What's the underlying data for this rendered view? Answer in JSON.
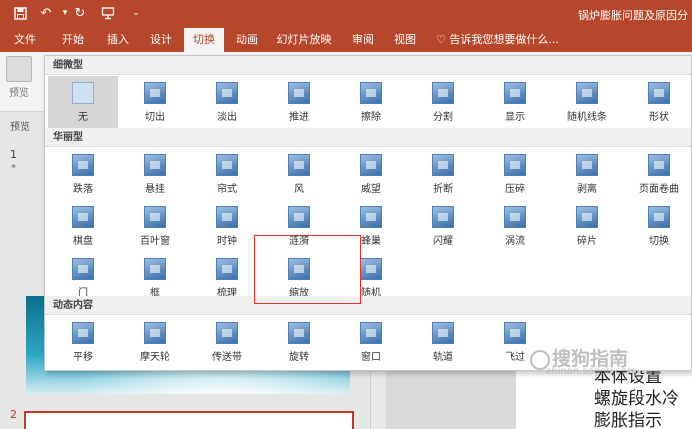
{
  "titlebar": {
    "title": "锅炉膨胀问题及原因分",
    "icons": [
      "save-icon",
      "undo-icon",
      "redo-icon",
      "present-from-start-icon",
      "customize-toolbar-icon"
    ]
  },
  "tabs": [
    {
      "label": "文件",
      "active": false
    },
    {
      "label": "开始",
      "active": false
    },
    {
      "label": "插入",
      "active": false
    },
    {
      "label": "设计",
      "active": false
    },
    {
      "label": "切换",
      "active": true
    },
    {
      "label": "动画",
      "active": false
    },
    {
      "label": "幻灯片放映",
      "active": false
    },
    {
      "label": "审阅",
      "active": false
    },
    {
      "label": "视图",
      "active": false
    }
  ],
  "tell_me": "♡ 告诉我您想要做什么...",
  "ribbon": {
    "preview_label": "预览",
    "preview_group_label": "预览"
  },
  "slides_pane": {
    "slide1_number": "1",
    "slide1_star": "*",
    "slide2_number": "2"
  },
  "slide": {
    "lines": [
      "本体设置",
      "螺旋段水冷",
      "膨胀指示"
    ]
  },
  "watermark": {
    "main": "搜狗指南",
    "sub": "zhinan.sogou.com"
  },
  "gallery": {
    "sections": [
      {
        "title": "细微型",
        "items": [
          {
            "label": "无",
            "icon": "none-transition-icon",
            "selected": true
          },
          {
            "label": "切出",
            "icon": "cut-transition-icon"
          },
          {
            "label": "淡出",
            "icon": "fade-transition-icon"
          },
          {
            "label": "推进",
            "icon": "push-transition-icon"
          },
          {
            "label": "擦除",
            "icon": "wipe-transition-icon"
          },
          {
            "label": "分割",
            "icon": "split-transition-icon"
          },
          {
            "label": "显示",
            "icon": "reveal-transition-icon"
          },
          {
            "label": "随机线条",
            "icon": "random-bars-transition-icon"
          },
          {
            "label": "形状",
            "icon": "shape-transition-icon"
          }
        ]
      },
      {
        "title": "华丽型",
        "items": [
          {
            "label": "跌落",
            "icon": "fall-over-transition-icon"
          },
          {
            "label": "悬挂",
            "icon": "drape-transition-icon"
          },
          {
            "label": "帘式",
            "icon": "curtains-transition-icon"
          },
          {
            "label": "风",
            "icon": "wind-transition-icon"
          },
          {
            "label": "威望",
            "icon": "prestige-transition-icon"
          },
          {
            "label": "折断",
            "icon": "fracture-transition-icon"
          },
          {
            "label": "压碎",
            "icon": "crush-transition-icon"
          },
          {
            "label": "剥离",
            "icon": "peel-off-transition-icon"
          },
          {
            "label": "页面卷曲",
            "icon": "page-curl-transition-icon"
          },
          {
            "label": "棋盘",
            "icon": "checkerboard-transition-icon"
          },
          {
            "label": "百叶窗",
            "icon": "blinds-transition-icon"
          },
          {
            "label": "时钟",
            "icon": "clock-transition-icon"
          },
          {
            "label": "涟漪",
            "icon": "ripple-transition-icon"
          },
          {
            "label": "蜂巢",
            "icon": "honeycomb-transition-icon"
          },
          {
            "label": "闪耀",
            "icon": "glitter-transition-icon"
          },
          {
            "label": "涡流",
            "icon": "vortex-transition-icon"
          },
          {
            "label": "碎片",
            "icon": "shred-transition-icon"
          },
          {
            "label": "切换",
            "icon": "switch-transition-icon"
          },
          {
            "label": "门",
            "icon": "doors-transition-icon"
          },
          {
            "label": "框",
            "icon": "box-transition-icon"
          },
          {
            "label": "梳理",
            "icon": "comb-transition-icon"
          },
          {
            "label": "缩放",
            "icon": "zoom-transition-icon"
          },
          {
            "label": "随机",
            "icon": "random-transition-icon"
          }
        ]
      },
      {
        "title": "动态内容",
        "items": [
          {
            "label": "平移",
            "icon": "pan-transition-icon"
          },
          {
            "label": "摩天轮",
            "icon": "ferris-wheel-transition-icon"
          },
          {
            "label": "传送带",
            "icon": "conveyor-transition-icon"
          },
          {
            "label": "旋转",
            "icon": "rotate-transition-icon"
          },
          {
            "label": "窗口",
            "icon": "window-transition-icon"
          },
          {
            "label": "轨道",
            "icon": "orbit-transition-icon"
          },
          {
            "label": "飞过",
            "icon": "fly-through-transition-icon"
          }
        ]
      }
    ]
  },
  "colors": {
    "titlebar": "#b7472a",
    "highlight_box": "#e03030",
    "selected_item": "#d6d6d6"
  }
}
